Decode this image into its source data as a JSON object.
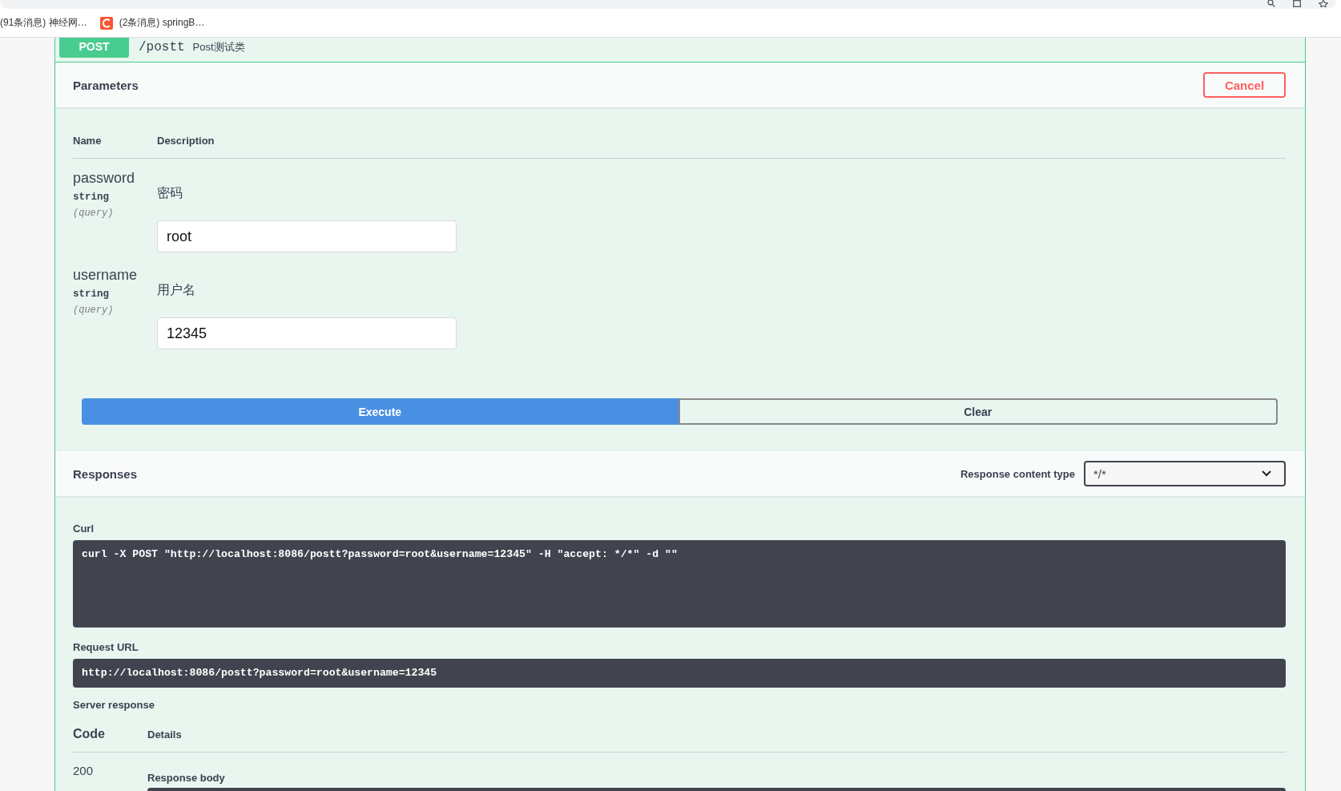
{
  "browser": {
    "bookmarks": [
      {
        "kind": "text",
        "label": "(91条消息) 神经网…"
      },
      {
        "kind": "favicon",
        "label": "(2条消息) springB…"
      }
    ]
  },
  "operation": {
    "method": "POST",
    "path": "/postt",
    "summary": "Post测试类"
  },
  "parameters": {
    "title": "Parameters",
    "cancel_button": "Cancel",
    "columns": [
      "Name",
      "Description"
    ],
    "rows": [
      {
        "name": "password",
        "type": "string",
        "location": "(query)",
        "description": "密码",
        "value": "root"
      },
      {
        "name": "username",
        "type": "string",
        "location": "(query)",
        "description": "用户名",
        "value": "12345"
      }
    ],
    "execute_button": "Execute",
    "clear_button": "Clear"
  },
  "responses": {
    "title": "Responses",
    "content_type_label": "Response content type",
    "content_type": "*/*",
    "curl": {
      "label": "Curl",
      "command": "curl -X POST \"http://localhost:8086/postt?password=root&username=12345\" -H \"accept: */*\" -d \"\""
    },
    "request_url": {
      "label": "Request URL",
      "url": "http://localhost:8086/postt?password=root&username=12345"
    },
    "server_response": {
      "label": "Server response",
      "columns": [
        "Code",
        "Details"
      ],
      "rows": [
        {
          "code": "200",
          "details_label": "Response body"
        }
      ]
    }
  }
}
